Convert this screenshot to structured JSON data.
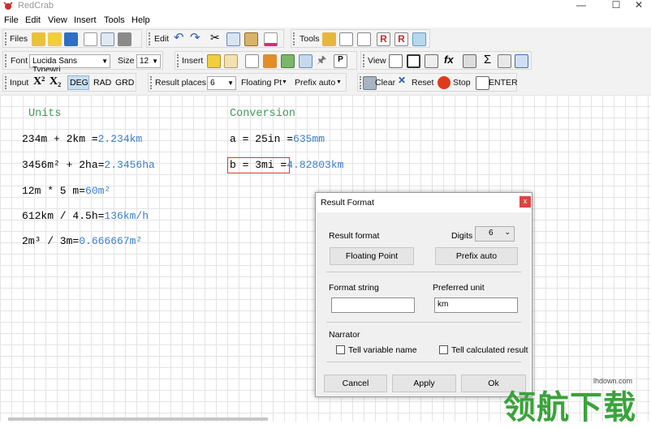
{
  "window": {
    "title": "RedCrab",
    "minimize": "—",
    "maximize": "☐",
    "close": "✕"
  },
  "menus": [
    "File",
    "Edit",
    "View",
    "Insert",
    "Tools",
    "Help"
  ],
  "toolbar": {
    "files": "Files",
    "edit": "Edit",
    "tools": "Tools",
    "font": "Font",
    "font_value": "Lucida Sans Typewri",
    "size": "Size",
    "size_value": "12",
    "insert": "Insert",
    "view": "View",
    "input": "Input",
    "x_super": "X²",
    "x_sub": "X₂",
    "deg": "DEG",
    "rad": "RAD",
    "grd": "GRD",
    "result_places": "Result places",
    "result_places_value": "6",
    "floating_pt": "Floating Pt",
    "prefix_auto": "Prefix auto",
    "clear": "Clear",
    "reset": "Reset",
    "stop": "Stop",
    "enter": "ENTER"
  },
  "worksheet": {
    "units_header": "Units",
    "conversion_header": "Conversion",
    "units": [
      {
        "expr": "234m + 2km =",
        "result": "2.234km"
      },
      {
        "expr": "3456m² + 2ha=",
        "result": "2.3456ha"
      },
      {
        "expr": "12m * 5 m=",
        "result": "60m²"
      },
      {
        "expr": "612km / 4.5h=",
        "result": "136km/h"
      },
      {
        "expr": "2m³ / 3m=",
        "result": "0.666667m²"
      }
    ],
    "conversion": [
      {
        "expr": "a = 25in =",
        "result": "635mm"
      },
      {
        "expr": "b = 3mi =",
        "result": "4.82803km"
      }
    ]
  },
  "dialog": {
    "title": "Result Format",
    "close": "x",
    "result_format": "Result format",
    "digits": "Digits",
    "digits_value": "6",
    "floating_point": "Floating Point",
    "prefix_auto": "Prefix auto",
    "format_string": "Format string",
    "format_string_value": "",
    "preferred_unit": "Preferred unit",
    "preferred_unit_value": "km",
    "narrator": "Narrator",
    "tell_variable": "Tell variable name",
    "tell_result": "Tell calculated result",
    "cancel": "Cancel",
    "apply": "Apply",
    "ok": "Ok"
  },
  "watermark": {
    "site": "lhdown.com",
    "text": "领航下载"
  }
}
